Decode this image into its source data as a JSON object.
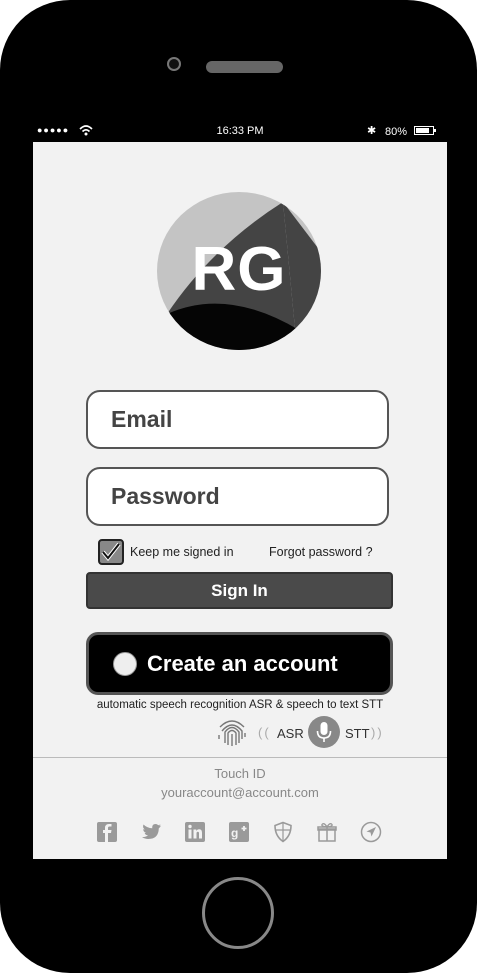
{
  "status_bar": {
    "signal": "●●●●●",
    "time": "16:33 PM",
    "bluetooth": "✱",
    "battery_percent": "80%"
  },
  "avatar": {
    "initials": "RG"
  },
  "login": {
    "email_placeholder": "Email",
    "password_placeholder": "Password",
    "keep_signed_in": "Keep me signed in",
    "keep_signed_in_checked": true,
    "forgot_password": "Forgot  password ?",
    "sign_in": "Sign In",
    "create_account": "Create an account"
  },
  "speech": {
    "caption": "automatic speech recognition ASR & speech to text STT",
    "paren_open": "((",
    "asr": "ASR",
    "stt": "STT",
    "paren_close": "))"
  },
  "footer": {
    "touch_id": "Touch ID",
    "account_email": "youraccount@account.com"
  },
  "social_icons": [
    "facebook-icon",
    "twitter-icon",
    "linkedin-icon",
    "google-plus-icon",
    "shield-icon",
    "gift-icon",
    "location-icon"
  ],
  "colors": {
    "phone_body": "#000000",
    "screen_bg": "#f2f2f2",
    "button_dark": "#4a4a4a",
    "icon_gray": "#9a9a9a"
  }
}
